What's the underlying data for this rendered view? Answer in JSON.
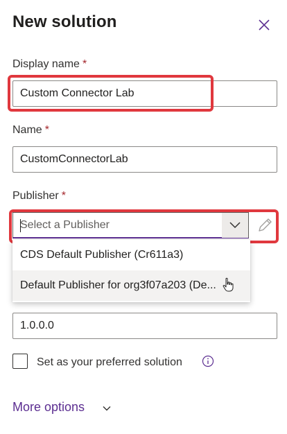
{
  "panel": {
    "title": "New solution",
    "close_icon": "close-icon"
  },
  "display_name": {
    "label": "Display name",
    "required_mark": "*",
    "value": "Custom Connector Lab"
  },
  "name": {
    "label": "Name",
    "required_mark": "*",
    "value": "CustomConnectorLab"
  },
  "publisher": {
    "label": "Publisher",
    "required_mark": "*",
    "placeholder": "Select a Publisher",
    "options": [
      "CDS Default Publisher (Cr611a3)",
      "Default Publisher for org3f07a203 (De..."
    ],
    "hovered_option_index": 1
  },
  "version": {
    "value": "1.0.0.0"
  },
  "preferred": {
    "label": "Set as your preferred solution",
    "checked": false
  },
  "more_options": {
    "label": "More options"
  },
  "colors": {
    "accent": "#5c2e91",
    "highlight": "#e0383e",
    "required": "#a4262c"
  }
}
